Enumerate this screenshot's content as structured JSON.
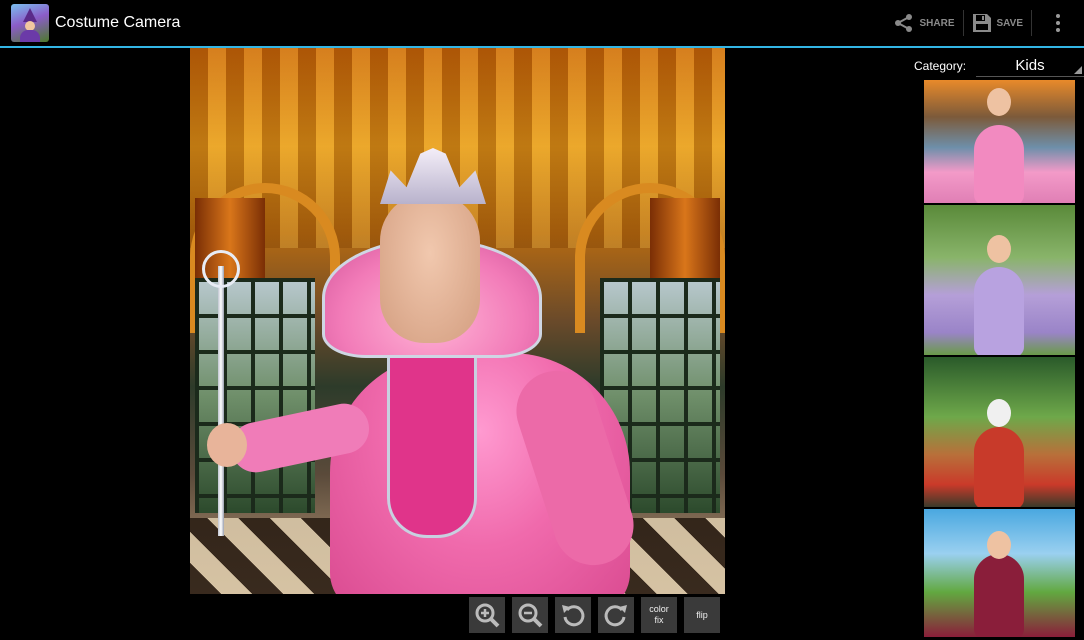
{
  "app": {
    "title": "Costume Camera"
  },
  "actionbar": {
    "share_label": "SHARE",
    "save_label": "SAVE"
  },
  "toolbar": {
    "color_fix_label": "color\nfix",
    "flip_label": "flip"
  },
  "category": {
    "label": "Category:",
    "selected": "Kids"
  },
  "colors": {
    "accent": "#33b5e5",
    "background": "#000000",
    "toolbar_button": "#3a3a3a"
  },
  "icons": {
    "share": "share-icon",
    "save": "save-icon",
    "overflow": "overflow-menu-icon",
    "zoom_in": "zoom-in-icon",
    "zoom_out": "zoom-out-icon",
    "rotate_left": "rotate-left-icon",
    "rotate_right": "rotate-right-icon"
  }
}
